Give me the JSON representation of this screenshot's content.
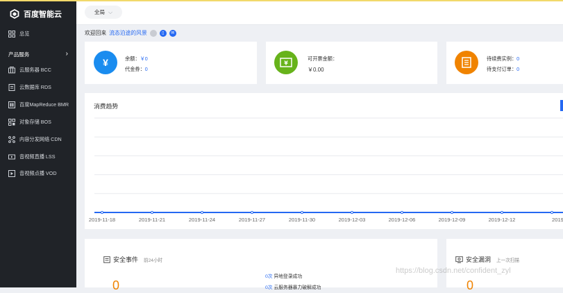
{
  "brand": {
    "name": "百度智能云"
  },
  "region": {
    "label": "全局"
  },
  "sidebar": {
    "overview": "总览",
    "section_label": "产品服务",
    "items": [
      {
        "label": "云服务器 BCC",
        "icon": "server-icon"
      },
      {
        "label": "云数据库 RDS",
        "icon": "database-icon"
      },
      {
        "label": "百度MapReduce BMR",
        "icon": "mapreduce-icon"
      },
      {
        "label": "对象存储 BOS",
        "icon": "storage-icon"
      },
      {
        "label": "内容分发网络 CDN",
        "icon": "network-icon"
      },
      {
        "label": "音视频直播 LSS",
        "icon": "live-icon"
      },
      {
        "label": "音视频点播 VOD",
        "icon": "vod-icon"
      }
    ]
  },
  "welcome": {
    "prefix": "欢迎回来",
    "username": "流态泊途的风景"
  },
  "account": {
    "balance_label": "余额：",
    "balance_value": "￥0",
    "voucher_label": "代金券：",
    "voucher_value": "0",
    "invoice_label": "可开票金额：",
    "invoice_value": "￥0.00",
    "renew_label": "待续费实例：",
    "renew_value": "0",
    "unpaid_label": "待支付订单：",
    "unpaid_value": "0"
  },
  "chart": {
    "title": "消费趋势"
  },
  "chart_data": {
    "type": "line",
    "title": "消费趋势",
    "x": [
      "2019-11-18",
      "2019-11-21",
      "2019-11-24",
      "2019-11-27",
      "2019-11-30",
      "2019-12-03",
      "2019-12-06",
      "2019-12-09",
      "2019-12-12",
      "2019"
    ],
    "series": [
      {
        "values": [
          0,
          0,
          0,
          0,
          0,
          0,
          0,
          0,
          0,
          0
        ]
      }
    ],
    "ylim": [
      0,
      1
    ],
    "grid": true,
    "colors": {
      "line": "#2468f2",
      "grid": "#e8eaee"
    }
  },
  "security": {
    "events_title": "安全事件",
    "events_sub": "前24小时",
    "events_count": "0",
    "event_lines": [
      {
        "count": "0次",
        "text": "异地登录成功"
      },
      {
        "count": "0次",
        "text": "云服务器暴力破解成功"
      }
    ],
    "vuln_title": "安全漏洞",
    "vuln_sub": "上一次扫描",
    "vuln_count": "0"
  },
  "watermark": "https://blog.csdn.net/confident_zyl",
  "colors": {
    "sidebar_bg": "#202328",
    "accent": "#2468f2",
    "balance_circle": "#1a8cef",
    "invoice_circle": "#67b31b",
    "renew_circle": "#f08300",
    "warning_orange": "#f08300"
  }
}
